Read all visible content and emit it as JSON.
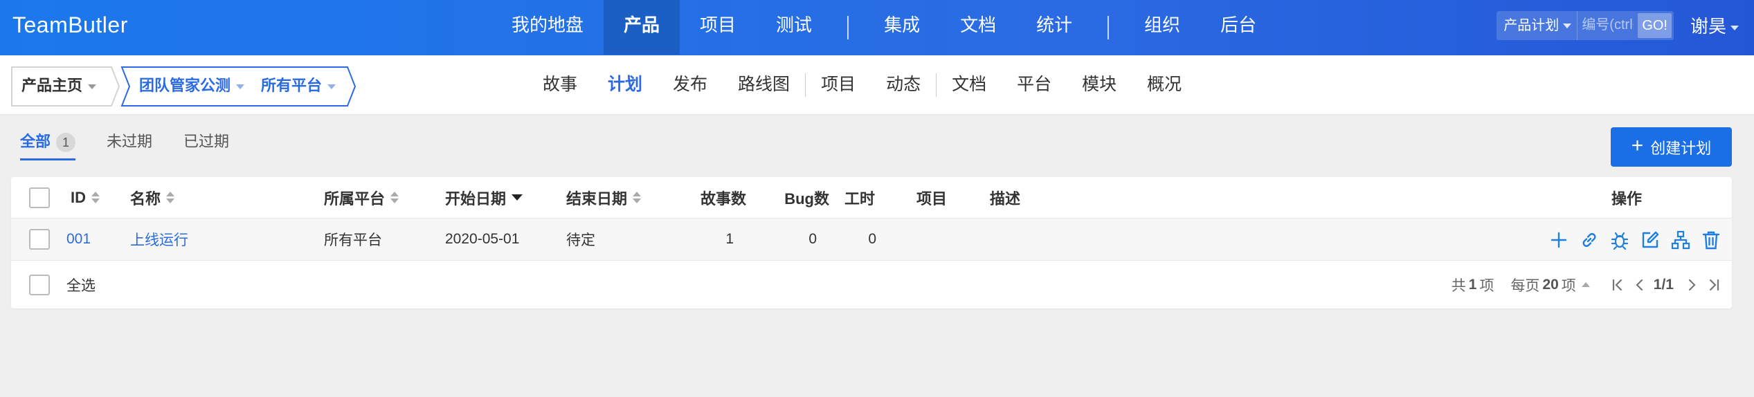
{
  "app": {
    "brand": "TeamButler"
  },
  "topnav": {
    "items": [
      {
        "label": "我的地盘"
      },
      {
        "label": "产品",
        "active": true
      },
      {
        "label": "项目"
      },
      {
        "label": "测试"
      },
      {
        "label": "集成"
      },
      {
        "label": "文档"
      },
      {
        "label": "统计"
      },
      {
        "label": "组织"
      },
      {
        "label": "后台"
      }
    ]
  },
  "search": {
    "type_label": "产品计划",
    "placeholder": "编号(ctrl+g)",
    "go_label": "GO!"
  },
  "user": {
    "name": "谢昊"
  },
  "breadcrumb": {
    "home": "产品主页",
    "product": "团队管家公测",
    "platform": "所有平台"
  },
  "subnav": {
    "items": [
      {
        "label": "故事"
      },
      {
        "label": "计划",
        "active": true
      },
      {
        "label": "发布"
      },
      {
        "label": "路线图"
      },
      {
        "label": "项目"
      },
      {
        "label": "动态"
      },
      {
        "label": "文档"
      },
      {
        "label": "平台"
      },
      {
        "label": "模块"
      },
      {
        "label": "概况"
      }
    ]
  },
  "filters": {
    "all": "全部",
    "all_count": "1",
    "not_expired": "未过期",
    "expired": "已过期"
  },
  "create_button": "创建计划",
  "table": {
    "columns": {
      "id": "ID",
      "name": "名称",
      "platform": "所属平台",
      "start": "开始日期",
      "end": "结束日期",
      "stories": "故事数",
      "bugs": "Bug数",
      "hours": "工时",
      "projects": "项目",
      "desc": "描述",
      "actions": "操作"
    },
    "rows": [
      {
        "id": "001",
        "name": "上线运行",
        "platform": "所有平台",
        "start": "2020-05-01",
        "end": "待定",
        "stories": "1",
        "bugs": "0",
        "hours": "0",
        "projects": "",
        "desc": ""
      }
    ],
    "select_all": "全选"
  },
  "pager": {
    "total_prefix": "共",
    "total": "1",
    "total_suffix": "项",
    "per_prefix": "每页",
    "per": "20",
    "per_suffix": "项",
    "page": "1/1"
  },
  "colors": {
    "header_blue": "#1b78ec",
    "accent": "#2a6be3",
    "button": "#1a6fe6"
  }
}
